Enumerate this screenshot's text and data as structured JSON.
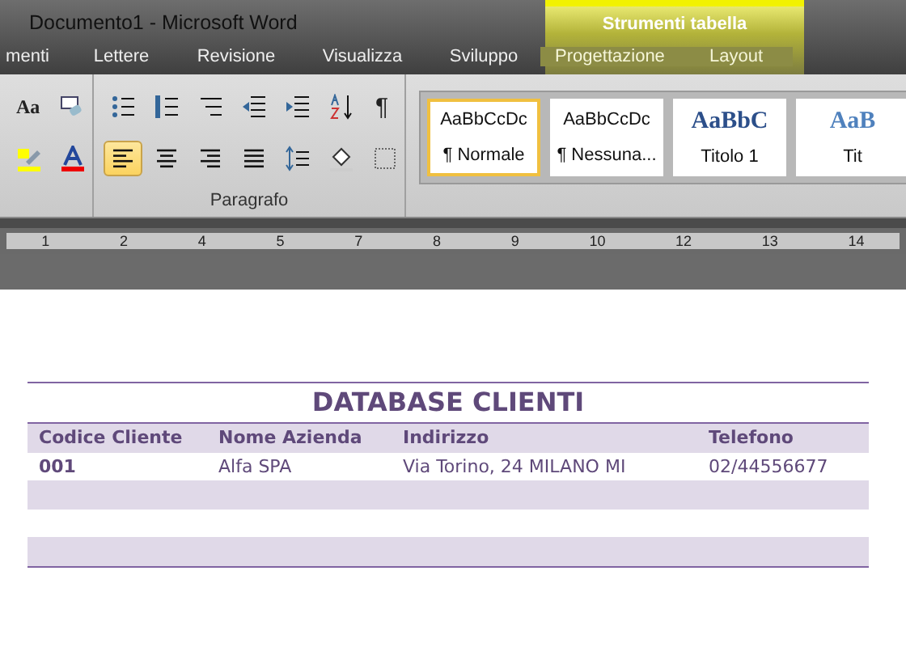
{
  "window": {
    "title": "Documento1  -  Microsoft Word"
  },
  "contextual_tab_group": {
    "label": "Strumenti tabella"
  },
  "tabs": [
    {
      "label": "menti",
      "contextual": false
    },
    {
      "label": "Lettere",
      "contextual": false
    },
    {
      "label": "Revisione",
      "contextual": false
    },
    {
      "label": "Visualizza",
      "contextual": false
    },
    {
      "label": "Sviluppo",
      "contextual": false
    },
    {
      "label": "Progettazione",
      "contextual": true
    },
    {
      "label": "Layout",
      "contextual": true
    }
  ],
  "font_group": {
    "change_case_label": "Aa"
  },
  "paragraph_group": {
    "label": "Paragrafo",
    "alignments": [
      {
        "kind": "left",
        "selected": true
      },
      {
        "kind": "center",
        "selected": false
      },
      {
        "kind": "right",
        "selected": false
      },
      {
        "kind": "justify",
        "selected": false
      }
    ],
    "show_marks_label": "¶"
  },
  "styles": [
    {
      "sample": "AaBbCcDc",
      "label": "¶ Normale",
      "kind": "body",
      "selected": true
    },
    {
      "sample": "AaBbCcDc",
      "label": "¶ Nessuna...",
      "kind": "body",
      "selected": false
    },
    {
      "sample": "AaBbC",
      "label": "Titolo 1",
      "kind": "heading",
      "selected": false
    },
    {
      "sample": "AaB",
      "label": "Tit",
      "kind": "heading2",
      "selected": false
    }
  ],
  "ruler": {
    "numbers": [
      "1",
      "2",
      "4",
      "5",
      "7",
      "8",
      "9",
      "10",
      "12",
      "13",
      "14"
    ]
  },
  "table": {
    "title": "DATABASE CLIENTI",
    "columns": [
      "Codice Cliente",
      "Nome Azienda",
      "Indirizzo",
      "Telefono"
    ],
    "rows": [
      [
        "001",
        "Alfa SPA",
        "Via Torino, 24 MILANO MI",
        "02/44556677"
      ],
      [
        "",
        "",
        "",
        ""
      ],
      [
        "",
        "",
        "",
        ""
      ],
      [
        "",
        "",
        "",
        ""
      ]
    ]
  }
}
